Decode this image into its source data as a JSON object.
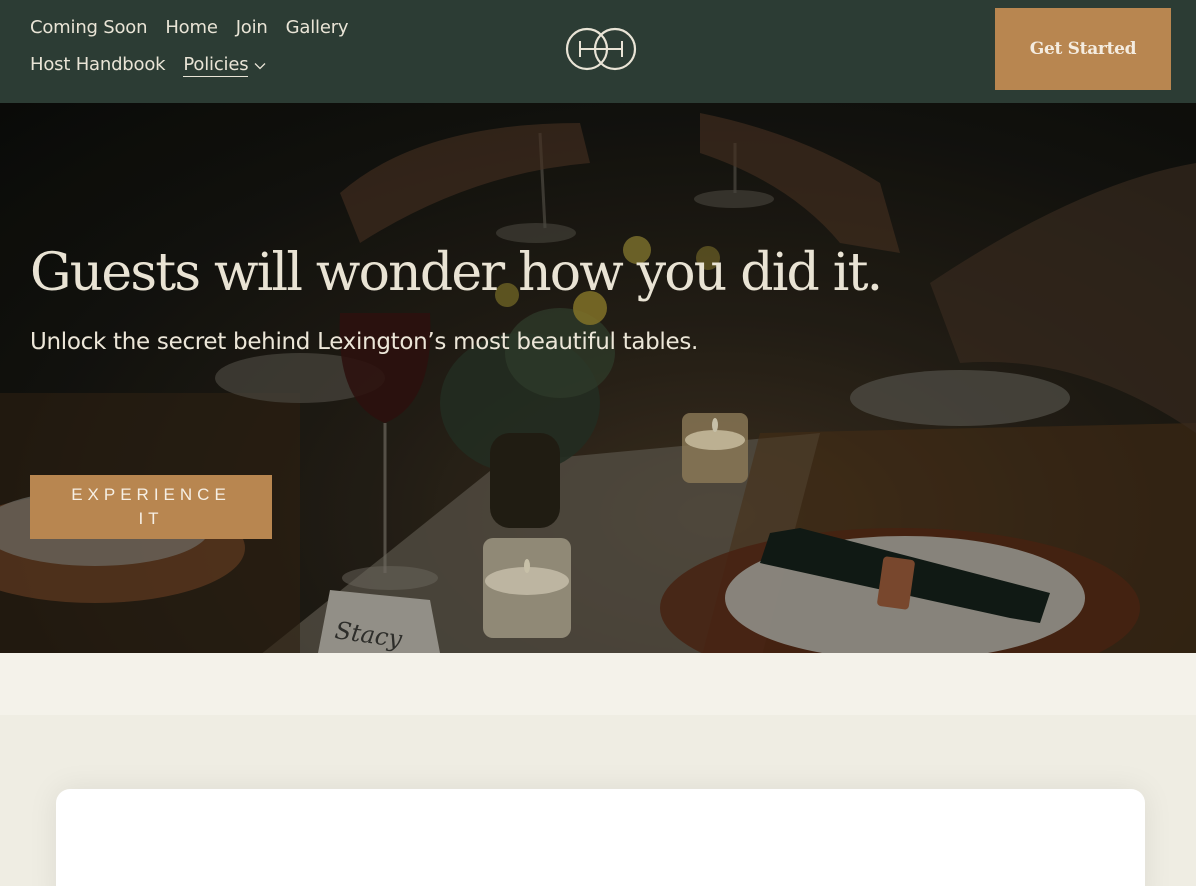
{
  "header": {
    "nav_row1": [
      "Coming Soon",
      "Home",
      "Join",
      "Gallery"
    ],
    "nav_row2": [
      "Host Handbook",
      "Policies"
    ],
    "active_item": "Policies",
    "cta_label": "Get Started"
  },
  "hero": {
    "title": "Guests will wonder how you did it.",
    "subtitle": "Unlock the secret behind Lexington’s most beautiful tables.",
    "button_label": "EXPERIENCE IT",
    "place_card_text": "Stacy"
  },
  "colors": {
    "header_bg": "#2c3c34",
    "accent": "#b88650",
    "cream": "#f4f2ea",
    "text_light": "#e9e4d6"
  },
  "icons": [
    "logo-icon",
    "chevron-down-icon"
  ]
}
